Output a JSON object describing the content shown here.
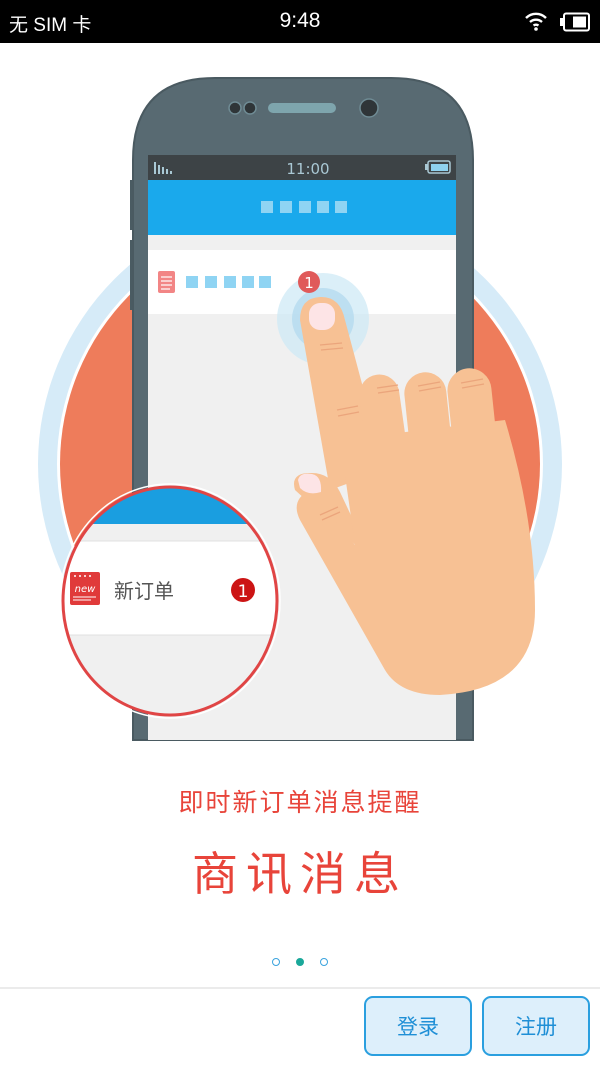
{
  "status_bar": {
    "carrier": "无 SIM 卡",
    "time": "9:48",
    "wifi_icon": "wifi-icon",
    "battery_icon": "battery-icon"
  },
  "illustration": {
    "phone_screen_time": "11:00",
    "zoom_bubble": {
      "item_icon": "new-order-icon",
      "item_icon_text": "new",
      "item_label": "新订单",
      "badge_count": "1"
    },
    "phone_badge_count": "1",
    "colors": {
      "ring": "#d4ebf8",
      "disc": "#ee7c5b",
      "phone_body": "#566870",
      "screen_header": "#1aa9ec",
      "skin": "#f7c194",
      "accent_red": "#e03a3a"
    }
  },
  "onboarding": {
    "tagline": "即时新订单消息提醒",
    "title": "商讯消息",
    "page_count": 3,
    "current_page": 2
  },
  "buttons": {
    "login_label": "登录",
    "register_label": "注册"
  }
}
